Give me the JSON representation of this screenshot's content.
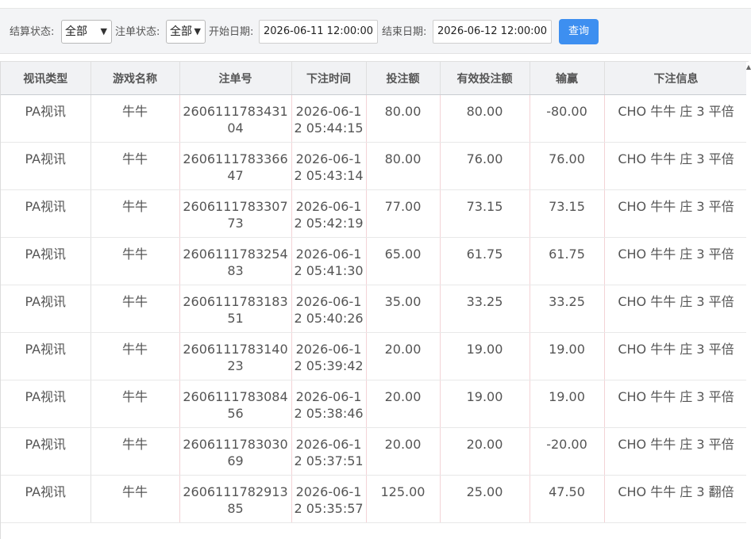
{
  "filters": {
    "settle_label": "结算状态:",
    "settle_value": "全部",
    "order_label": "注单状态:",
    "order_value": "全部",
    "start_label": "开始日期:",
    "start_value": "2026-06-11 12:00:00",
    "end_label": "结束日期:",
    "end_value": "2026-06-12 12:00:00",
    "query_label": "查询"
  },
  "table": {
    "headers": [
      "视讯类型",
      "游戏名称",
      "注单号",
      "下注时间",
      "投注额",
      "有效投注额",
      "输赢",
      "下注信息"
    ],
    "rows": [
      [
        "PA视讯",
        "牛牛",
        "260611178343104",
        "2026-06-12 05:44:15",
        "80.00",
        "80.00",
        "-80.00",
        "CHO 牛牛 庄 3 平倍"
      ],
      [
        "PA视讯",
        "牛牛",
        "260611178336647",
        "2026-06-12 05:43:14",
        "80.00",
        "76.00",
        "76.00",
        "CHO 牛牛 庄 3 平倍"
      ],
      [
        "PA视讯",
        "牛牛",
        "260611178330773",
        "2026-06-12 05:42:19",
        "77.00",
        "73.15",
        "73.15",
        "CHO 牛牛 庄 3 平倍"
      ],
      [
        "PA视讯",
        "牛牛",
        "260611178325483",
        "2026-06-12 05:41:30",
        "65.00",
        "61.75",
        "61.75",
        "CHO 牛牛 庄 3 平倍"
      ],
      [
        "PA视讯",
        "牛牛",
        "260611178318351",
        "2026-06-12 05:40:26",
        "35.00",
        "33.25",
        "33.25",
        "CHO 牛牛 庄 3 平倍"
      ],
      [
        "PA视讯",
        "牛牛",
        "260611178314023",
        "2026-06-12 05:39:42",
        "20.00",
        "19.00",
        "19.00",
        "CHO 牛牛 庄 3 平倍"
      ],
      [
        "PA视讯",
        "牛牛",
        "260611178308456",
        "2026-06-12 05:38:46",
        "20.00",
        "19.00",
        "19.00",
        "CHO 牛牛 庄 3 平倍"
      ],
      [
        "PA视讯",
        "牛牛",
        "260611178303069",
        "2026-06-12 05:37:51",
        "20.00",
        "20.00",
        "-20.00",
        "CHO 牛牛 庄 3 平倍"
      ],
      [
        "PA视讯",
        "牛牛",
        "260611178291385",
        "2026-06-12 05:35:57",
        "125.00",
        "25.00",
        "47.50",
        "CHO 牛牛 庄 3 翻倍"
      ]
    ]
  },
  "colors": {
    "query_button": "#3d8ff0",
    "header_bg": "#f1f2f4",
    "filter_bg": "#f3f4f6"
  }
}
